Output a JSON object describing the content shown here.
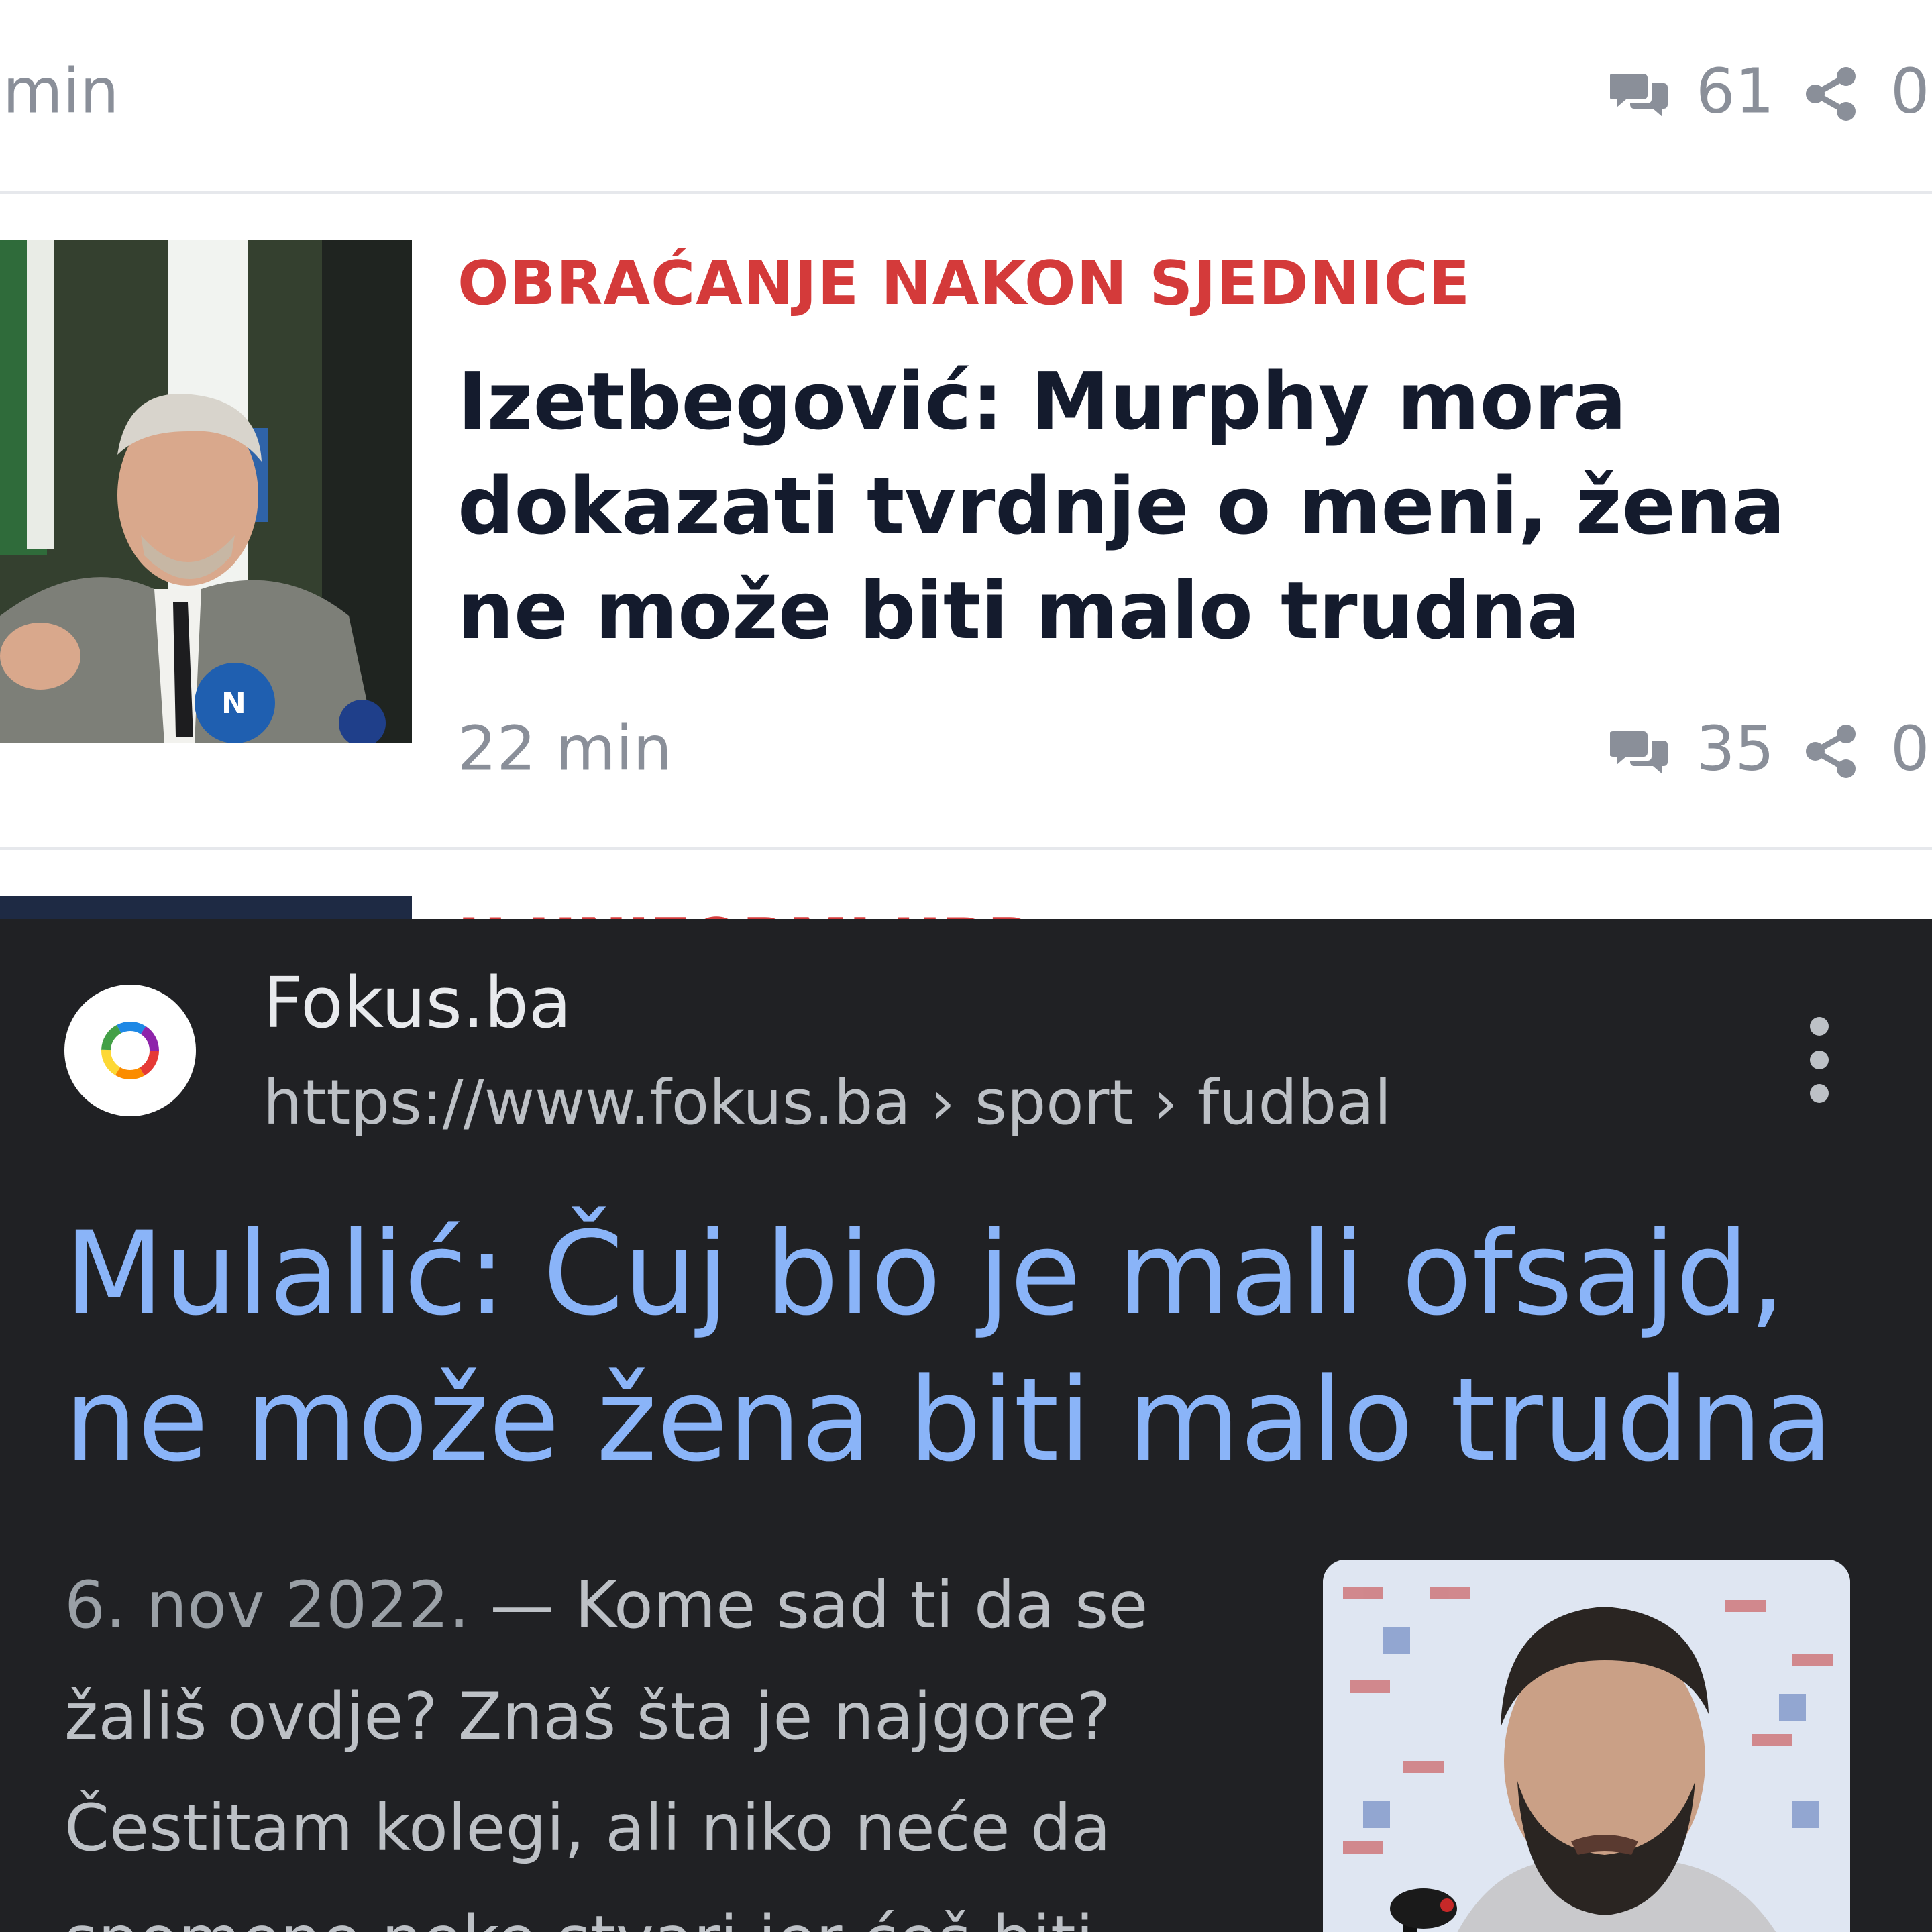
{
  "top_feed": {
    "prev_article": {
      "time": "min",
      "comments": "61",
      "shares": "0"
    },
    "article_1": {
      "kicker": "OBRAĆANJE NAKON SJEDNICE",
      "headline": "Izetbegović: Murphy mora dokazati tvrdnje o meni, žena ne može biti malo trudna",
      "time": "22 min",
      "comments": "35",
      "shares": "0"
    },
    "article_2": {
      "kicker_partial": "U UNIFORMI UBRA A"
    }
  },
  "search_result": {
    "site_name": "Fokus.ba",
    "url": "https://www.fokus.ba › sport › fudbal",
    "title": "Mulalić: Čuj bio je mali ofsajd, ne može žena biti malo trudna",
    "date": "6. nov 2022.",
    "snippet": " — Kome sad ti da se žališ ovdje? Znaš šta je najgore? Čestitam kolegi, ali niko neće da spomene neke stvari jer ćeš biti ..."
  },
  "colors": {
    "kicker_red": "#d43a3a",
    "headline_navy": "#141b2d",
    "meta_gray": "#8a8f99",
    "dark_bg": "#202124",
    "link_blue": "#8ab4f8"
  },
  "icons": [
    "comment-icon",
    "share-icon",
    "more-vert-icon",
    "site-logo-icon"
  ]
}
